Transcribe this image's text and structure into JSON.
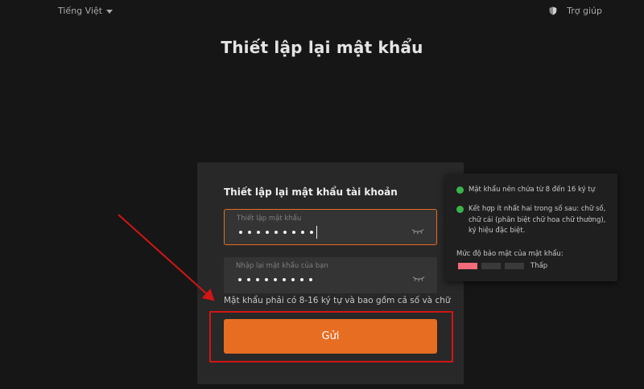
{
  "header": {
    "language": "Tiếng Việt",
    "help": "Trợ giúp"
  },
  "page_title": "Thiết lập lại mật khẩu",
  "form": {
    "title": "Thiết lập lại mật khẩu tài khoản",
    "password_label": "Thiết lập mật khẩu",
    "password_dot_count": 9,
    "confirm_label": "Nhập lại mật khẩu của bạn",
    "confirm_dot_count": 9,
    "hint": "Mật khẩu phải có 8-16 ký tự và bao gồm cả số và chữ",
    "submit_label": "Gửi"
  },
  "requirements": {
    "items": [
      "Mật khẩu nên chứa từ 8 đến 16 ký tự",
      "Kết hợp ít nhất hai trong số sau: chữ số, chữ cái (phân biệt chữ hoa chữ thường), ký hiệu đặc biệt."
    ],
    "strength_label": "Mức độ bảo mật của mật khẩu:",
    "strength_level": "Thấp",
    "strength_filled": 1,
    "strength_total": 3
  },
  "colors": {
    "accent": "#e76d22",
    "check": "#3bb34a",
    "strength_low": "#f56b7a",
    "annotation": "#d21515"
  },
  "icons": {
    "language_caret": "caret-down-icon",
    "help": "shield-icon",
    "toggle_visibility": "eye-closed-icon",
    "requirement_met": "check-dot-icon"
  }
}
